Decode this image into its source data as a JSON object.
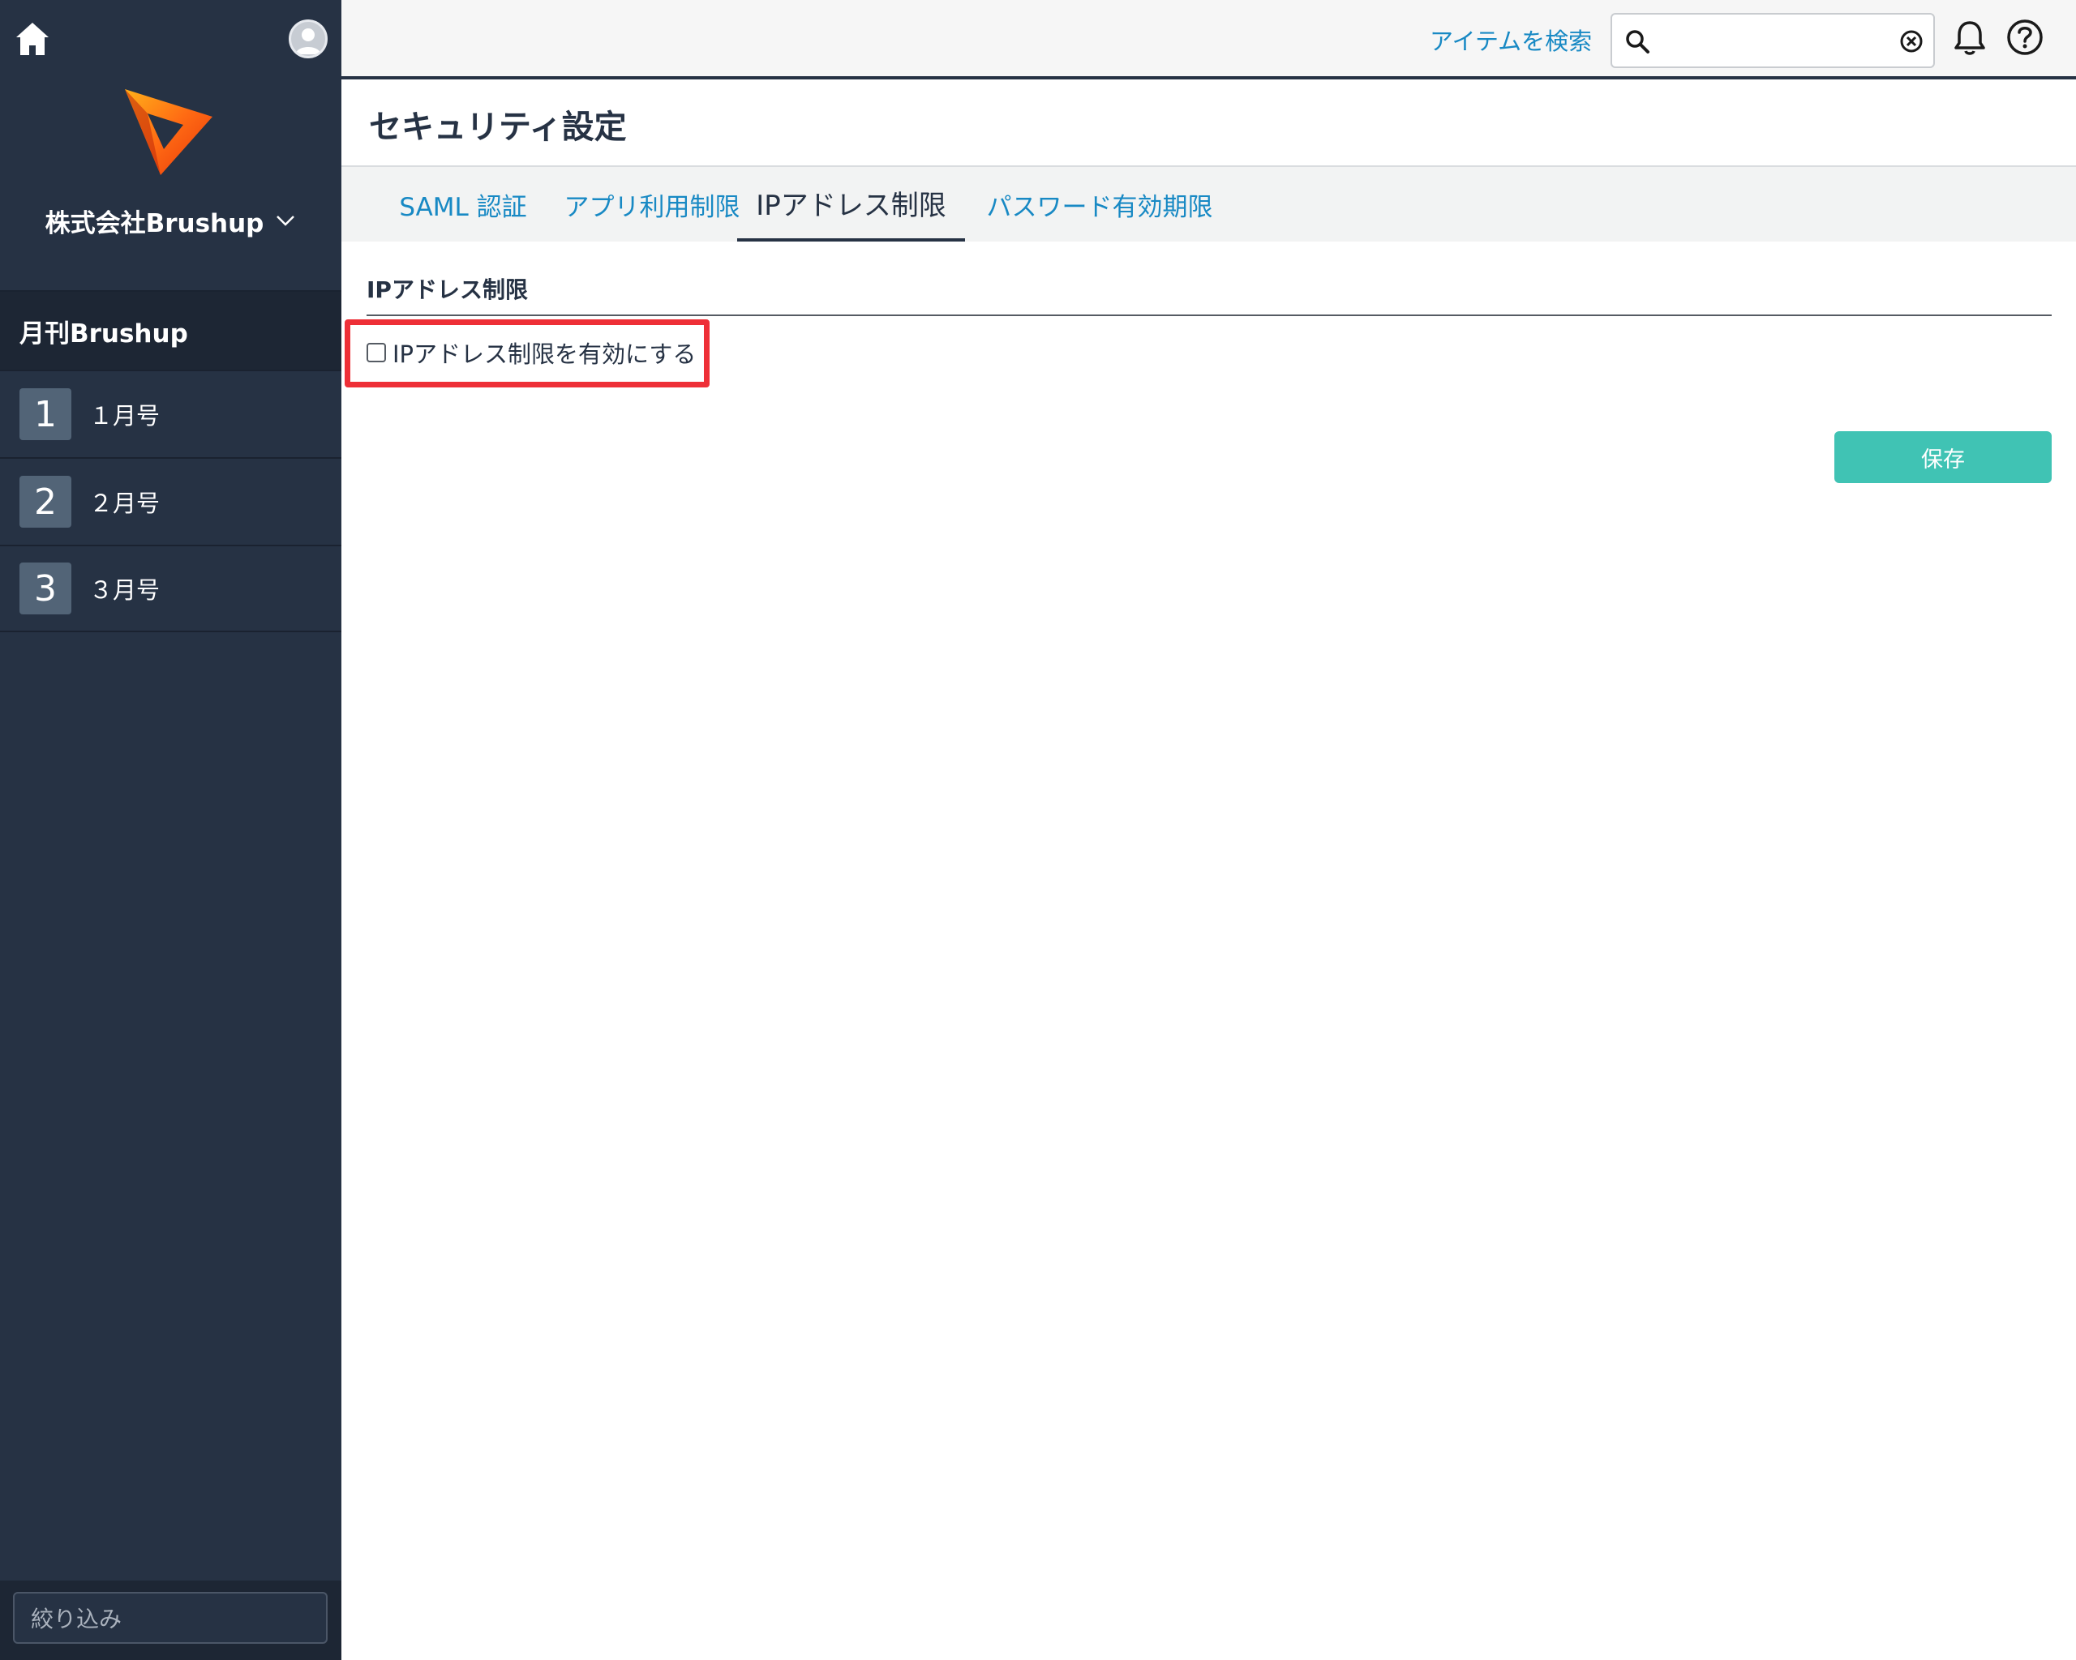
{
  "sidebar": {
    "company_name": "株式会社Brushup",
    "project_title": "月刊Brushup",
    "issues": [
      {
        "number": "1",
        "label": "１月号"
      },
      {
        "number": "2",
        "label": "２月号"
      },
      {
        "number": "3",
        "label": "３月号"
      }
    ],
    "filter_placeholder": "絞り込み"
  },
  "topbar": {
    "search_label": "アイテムを検索",
    "search_value": ""
  },
  "page": {
    "title": "セキュリティ設定",
    "tabs": [
      {
        "label": "SAML 認証",
        "active": false
      },
      {
        "label": "アプリ利用制限",
        "active": false
      },
      {
        "label": "IPアドレス制限",
        "active": true
      },
      {
        "label": "パスワード有効期限",
        "active": false
      }
    ],
    "section_title": "IPアドレス制限",
    "checkbox_label": "IPアドレス制限を有効にする",
    "checkbox_checked": false,
    "save_label": "保存"
  },
  "colors": {
    "sidebar_bg": "#263244",
    "link": "#1889c4",
    "save_button": "#40c3b4",
    "highlight": "#ee2f37"
  },
  "icons": [
    "home-icon",
    "avatar-icon",
    "brushup-logo",
    "chevron-down-icon",
    "search-icon",
    "clear-icon",
    "bell-icon",
    "help-icon"
  ]
}
